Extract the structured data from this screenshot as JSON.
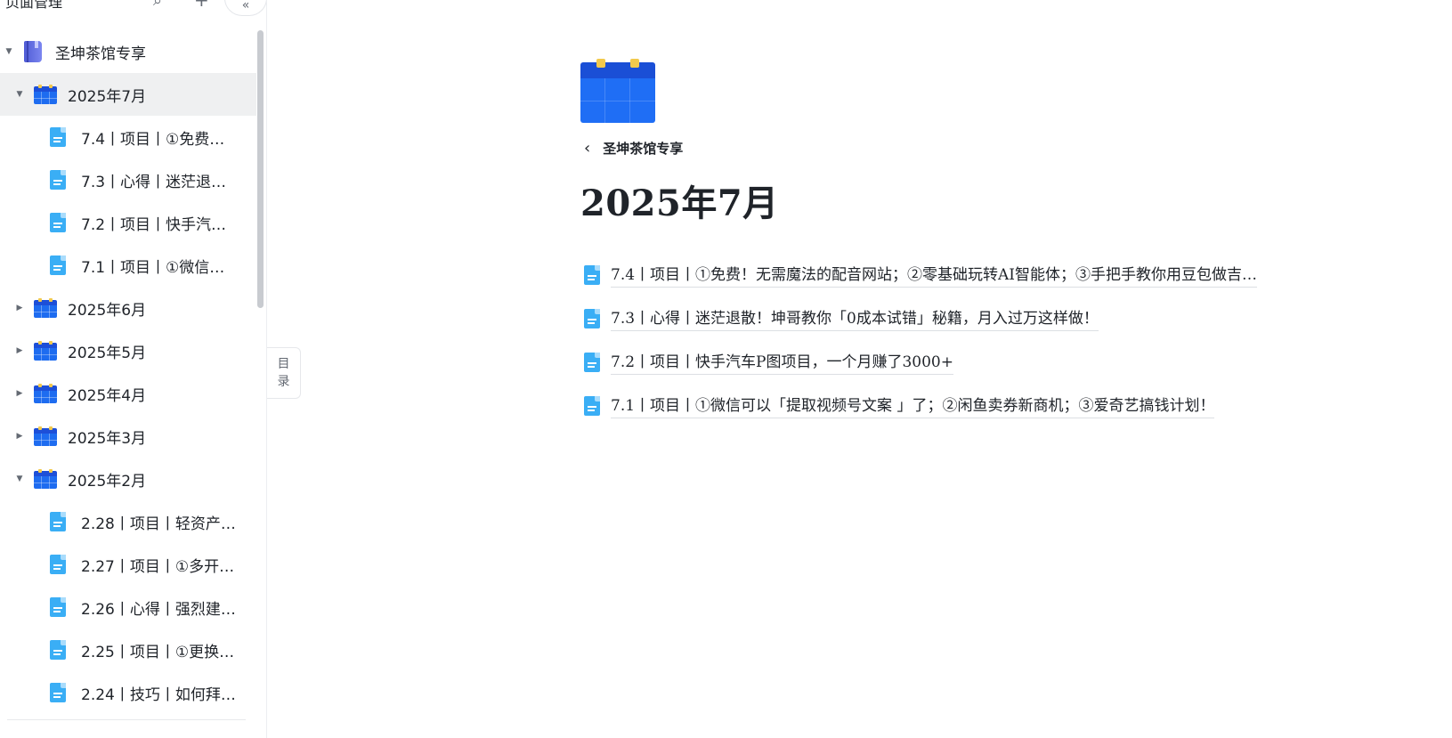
{
  "sidebar": {
    "title": "页面管理",
    "root": {
      "label": "圣坤茶馆专享"
    },
    "items": [
      {
        "label": "2025年7月",
        "expanded": true,
        "active": true,
        "children": [
          "7.4丨项目丨①免费…",
          "7.3丨心得丨迷茫退…",
          "7.2丨项目丨快手汽…",
          "7.1丨项目丨①微信…"
        ]
      },
      {
        "label": "2025年6月",
        "expanded": false
      },
      {
        "label": "2025年5月",
        "expanded": false
      },
      {
        "label": "2025年4月",
        "expanded": false
      },
      {
        "label": "2025年3月",
        "expanded": false
      },
      {
        "label": "2025年2月",
        "expanded": true,
        "children": [
          "2.28丨项目丨轻资产…",
          "2.27丨项目丨①多开…",
          "2.26丨心得丨强烈建…",
          "2.25丨项目丨①更换…",
          "2.24丨技巧丨如何拜…"
        ]
      }
    ]
  },
  "toc_tab": {
    "line1": "目",
    "line2": "录"
  },
  "main": {
    "breadcrumb": "圣坤茶馆专享",
    "title": "2025年7月",
    "children": [
      "7.4丨项目丨①免费！无需魔法的配音网站；②零基础玩转AI智能体；③手把手教你用豆包做吉…",
      "7.3丨心得丨迷茫退散！坤哥教你「0成本试错」秘籍，月入过万这样做！",
      "7.2丨项目丨快手汽车P图项目，一个月赚了3000+",
      "7.1丨项目丨①微信可以「提取视频号文案 」了；②闲鱼卖券新商机；③爱奇艺搞钱计划！"
    ]
  },
  "colors": {
    "calendar_blue": "#1f6ef5",
    "calendar_ring": "#f2c94c",
    "doc_blue": "#3aaef5",
    "book_purple": "#4f5bd5"
  }
}
